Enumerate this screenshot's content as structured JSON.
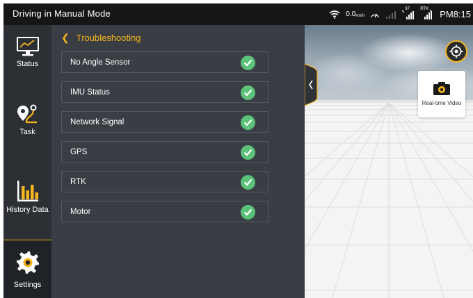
{
  "status_bar": {
    "title": "Driving in Manual Mode",
    "speed_value": "0.0",
    "speed_unit": "km/h",
    "sat_count": "37",
    "rtk_label": "RTK",
    "time": "PM8:15",
    "icons": [
      "wifi-icon",
      "speedometer-icon",
      "signal-weak-icon",
      "satellite-signal-icon",
      "rtk-signal-icon"
    ]
  },
  "sidebar": {
    "items": [
      {
        "label": "Status",
        "icon": "monitor-chart-icon"
      },
      {
        "label": "Task",
        "icon": "route-pin-icon"
      },
      {
        "label": "History Data",
        "icon": "bar-chart-icon"
      },
      {
        "label": "Settings",
        "icon": "gear-icon",
        "active": true
      }
    ]
  },
  "panel": {
    "back_title": "Troubleshooting",
    "items": [
      {
        "label": "No Angle Sensor",
        "status": "ok"
      },
      {
        "label": "IMU Status",
        "status": "ok"
      },
      {
        "label": "Network Signal",
        "status": "ok"
      },
      {
        "label": "GPS",
        "status": "ok"
      },
      {
        "label": "RTK",
        "status": "ok"
      },
      {
        "label": "Motor",
        "status": "ok"
      }
    ]
  },
  "view": {
    "video_label": "Real-time Video",
    "icons": [
      "collapse-chevron-icon",
      "locate-icon",
      "camera-icon"
    ]
  },
  "colors": {
    "accent": "#f5b51c",
    "ok_green": "#5cc27a",
    "sidebar_bg": "#2c3035",
    "panel_bg": "#3a3e44"
  }
}
